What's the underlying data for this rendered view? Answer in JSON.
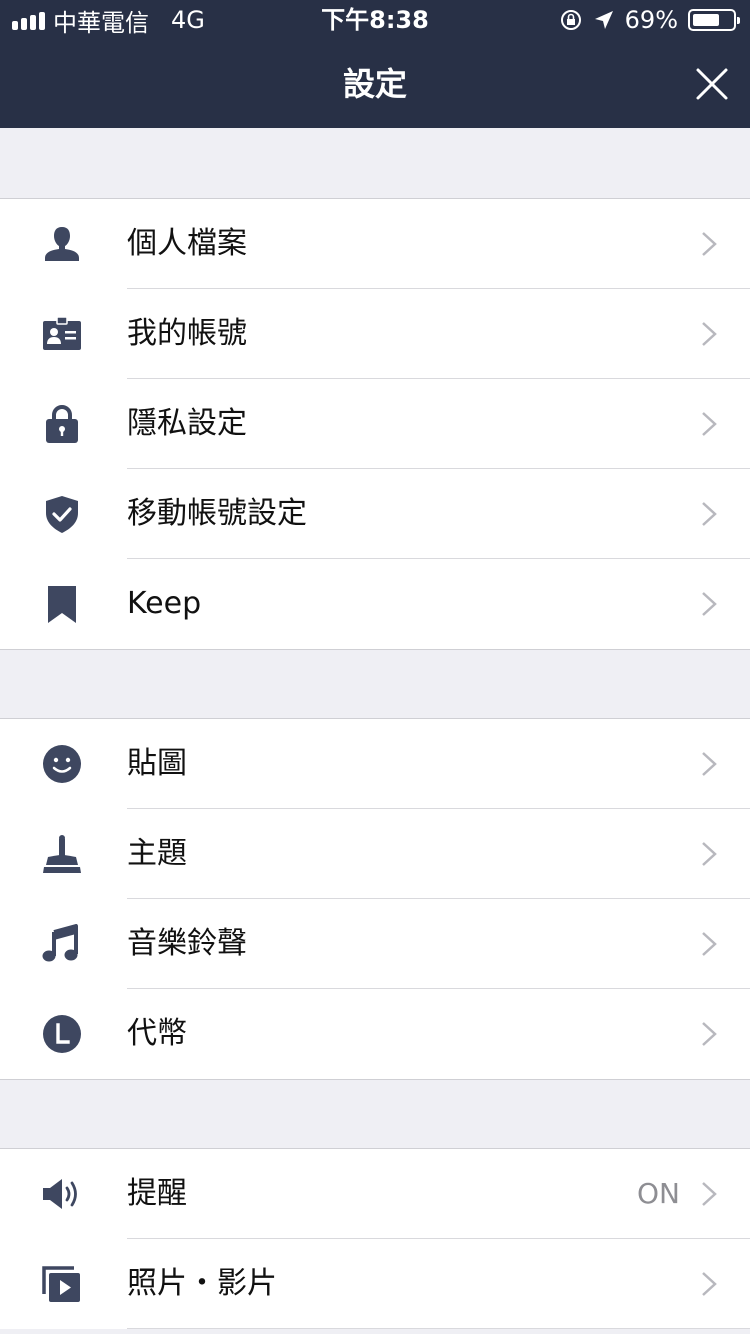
{
  "status_bar": {
    "carrier": "中華電信",
    "network": "4G",
    "time": "下午8:38",
    "battery": "69%",
    "battery_level": 0.69
  },
  "header": {
    "title": "設定"
  },
  "sections": [
    {
      "items": [
        {
          "label": "個人檔案",
          "icon": "person-icon"
        },
        {
          "label": "我的帳號",
          "icon": "id-card-icon"
        },
        {
          "label": "隱私設定",
          "icon": "lock-icon"
        },
        {
          "label": "移動帳號設定",
          "icon": "shield-check-icon"
        },
        {
          "label": "Keep",
          "icon": "bookmark-icon"
        }
      ]
    },
    {
      "items": [
        {
          "label": "貼圖",
          "icon": "smiley-icon"
        },
        {
          "label": "主題",
          "icon": "brush-icon"
        },
        {
          "label": "音樂鈴聲",
          "icon": "music-note-icon"
        },
        {
          "label": "代幣",
          "icon": "coin-icon"
        }
      ]
    },
    {
      "items": [
        {
          "label": "提醒",
          "icon": "speaker-icon",
          "value": "ON"
        },
        {
          "label": "照片・影片",
          "icon": "photo-video-icon"
        }
      ]
    }
  ],
  "colors": {
    "header_bg": "#283046",
    "icon": "#3e4760",
    "chevron": "#b8b8be",
    "page_bg": "#efeff4"
  }
}
